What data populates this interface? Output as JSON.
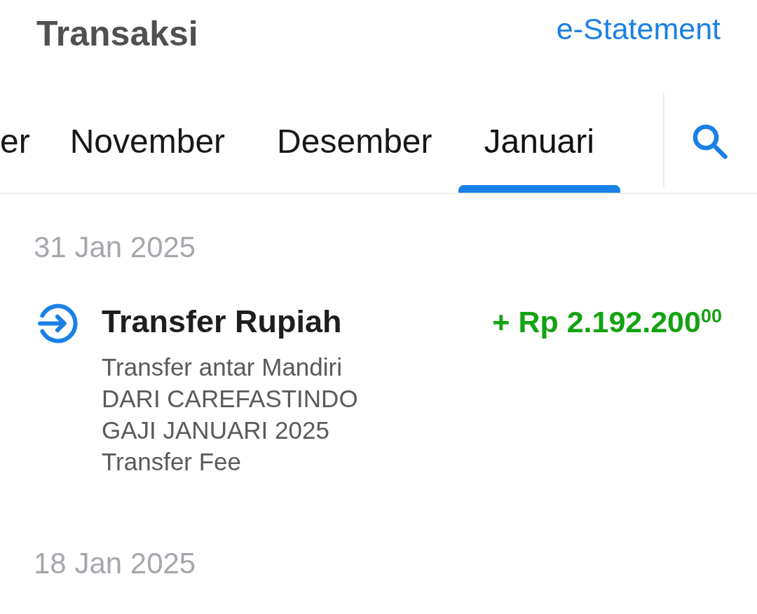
{
  "header": {
    "title": "Transaksi",
    "statement_link": "e-Statement"
  },
  "month_tabs": [
    {
      "label": "er",
      "selected": false
    },
    {
      "label": "November",
      "selected": false
    },
    {
      "label": "Desember",
      "selected": false
    },
    {
      "label": "Januari",
      "selected": true
    }
  ],
  "groups": [
    {
      "date": "31 Jan 2025",
      "transactions": [
        {
          "kind": "credit",
          "title": "Transfer Rupiah",
          "details": [
            "Transfer antar Mandiri",
            "DARI CAREFASTINDO",
            "GAJI JANUARI 2025",
            "Transfer Fee"
          ],
          "amount": "+ Rp 2.192.200$^{00}$"
        }
      ]
    },
    {
      "date": "18 Jan 2025"
    }
  ]
}
